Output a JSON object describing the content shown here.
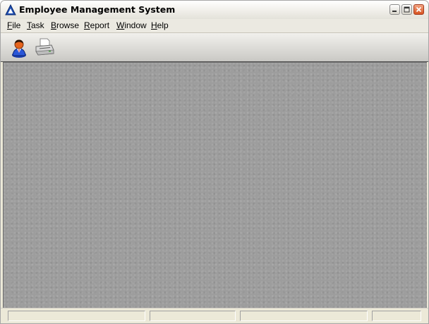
{
  "window": {
    "title": "Employee Management System",
    "title_bar_colors": {
      "close_button": "#d7521f",
      "mdi_background": "#9d9d9d"
    }
  },
  "menu": {
    "items": [
      {
        "label_accel": "F",
        "label_rest": "ile"
      },
      {
        "label_accel": "T",
        "label_rest": "ask"
      },
      {
        "label_accel": "B",
        "label_rest": "rowse"
      },
      {
        "label_accel": "R",
        "label_rest": "eport"
      },
      {
        "label_accel": "W",
        "label_rest": "indow"
      },
      {
        "label_accel": "H",
        "label_rest": "elp"
      }
    ]
  },
  "toolbar": {
    "buttons": [
      {
        "icon": "employee-user-icon"
      },
      {
        "icon": "printer-icon"
      }
    ]
  },
  "statusbar": {
    "panels": [
      "",
      "",
      "",
      ""
    ]
  }
}
